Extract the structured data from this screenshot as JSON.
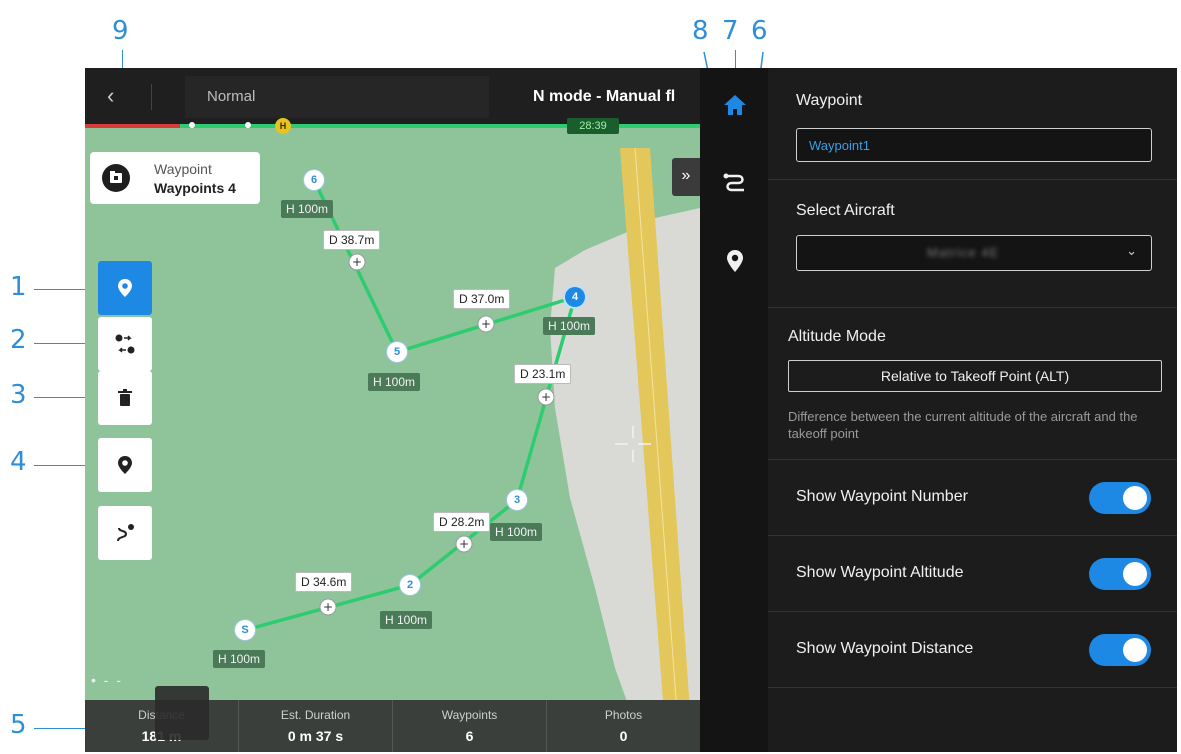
{
  "callouts": [
    "1",
    "2",
    "3",
    "4",
    "5",
    "6",
    "7",
    "8",
    "9"
  ],
  "topbar": {
    "mode": "Normal",
    "status": "N mode - Manual fl",
    "timer": "28:39",
    "home_marker": "H"
  },
  "route_card": {
    "type": "Waypoint",
    "name": "Waypoints 4"
  },
  "waypoints": [
    {
      "id": "S",
      "altitude": "H 100m"
    },
    {
      "id": "2",
      "altitude": "H 100m"
    },
    {
      "id": "3",
      "altitude": "H 100m"
    },
    {
      "id": "4",
      "altitude": "H 100m",
      "selected": true
    },
    {
      "id": "5",
      "altitude": "H 100m"
    },
    {
      "id": "6",
      "altitude": "H 100m"
    }
  ],
  "segments": [
    "D 34.6m",
    "D 28.2m",
    "D 23.1m",
    "D 37.0m",
    "D 38.7m"
  ],
  "stats": [
    {
      "label": "Distance",
      "value": "181 m"
    },
    {
      "label": "Est. Duration",
      "value": "0 m 37 s"
    },
    {
      "label": "Waypoints",
      "value": "6"
    },
    {
      "label": "Photos",
      "value": "0"
    }
  ],
  "map_dots": "• - -",
  "expand_label": "»",
  "back_label": "‹",
  "panel": {
    "name_title": "Waypoint",
    "name_value": "Waypoint1",
    "aircraft_title": "Select Aircraft",
    "aircraft_value": "Matrice 4E",
    "aircraft_caret": "⌄",
    "altitude_title": "Altitude Mode",
    "altitude_mode": "Relative to Takeoff Point (ALT)",
    "altitude_desc": "Difference between the current altitude of the aircraft and the takeoff point",
    "toggles": [
      {
        "label": "Show Waypoint Number",
        "on": true
      },
      {
        "label": "Show Waypoint Altitude",
        "on": true
      },
      {
        "label": "Show Waypoint Distance",
        "on": true
      }
    ]
  },
  "colors": {
    "accent": "#1e88e5",
    "map_green": "#8fc49a",
    "route_line": "#2ecc71",
    "runway": "#e3c75b"
  },
  "icons": {
    "route_icon": "folder-icon",
    "tools": [
      "waypoint-pin-icon",
      "reverse-route-icon",
      "trash-icon",
      "location-pin-icon",
      "route-draw-icon"
    ],
    "nav": [
      "home-icon",
      "route-icon",
      "pin-icon"
    ]
  }
}
